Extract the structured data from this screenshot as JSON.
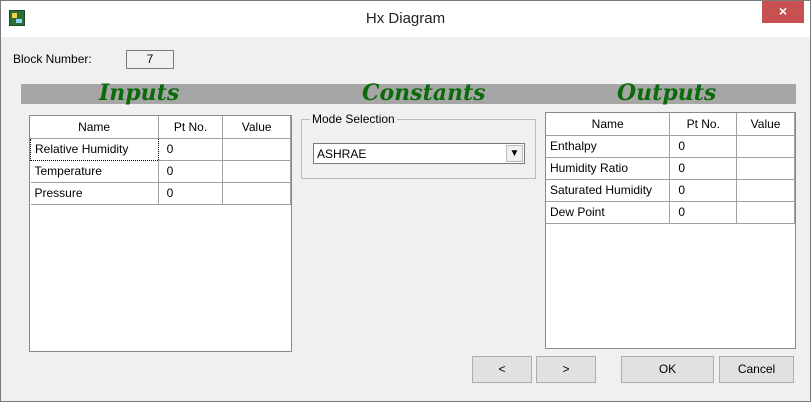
{
  "window": {
    "title": "Hx Diagram",
    "close_label": "×"
  },
  "block": {
    "label": "Block Number:",
    "value": "7"
  },
  "sections": {
    "inputs": "Inputs",
    "constants": "Constants",
    "outputs": "Outputs"
  },
  "inputs": {
    "columns": [
      "Name",
      "Pt No.",
      "Value"
    ],
    "rows": [
      {
        "name": "Relative Humidity",
        "pt": "0",
        "value": ""
      },
      {
        "name": "Temperature",
        "pt": "0",
        "value": ""
      },
      {
        "name": "Pressure",
        "pt": "0",
        "value": ""
      }
    ]
  },
  "constants": {
    "legend": "Mode Selection",
    "selected": "ASHRAE",
    "arrow": "▼"
  },
  "outputs": {
    "columns": [
      "Name",
      "Pt No.",
      "Value"
    ],
    "rows": [
      {
        "name": "Enthalpy",
        "pt": "0",
        "value": ""
      },
      {
        "name": "Humidity Ratio",
        "pt": "0",
        "value": ""
      },
      {
        "name": "Saturated Humidity",
        "pt": "0",
        "value": ""
      },
      {
        "name": "Dew Point",
        "pt": "0",
        "value": ""
      }
    ]
  },
  "buttons": {
    "prev": "<",
    "next": ">",
    "ok": "OK",
    "cancel": "Cancel"
  },
  "colors": {
    "section_title": "#0b6b0b",
    "header_band": "#a6a6a6",
    "close": "#c75050"
  }
}
